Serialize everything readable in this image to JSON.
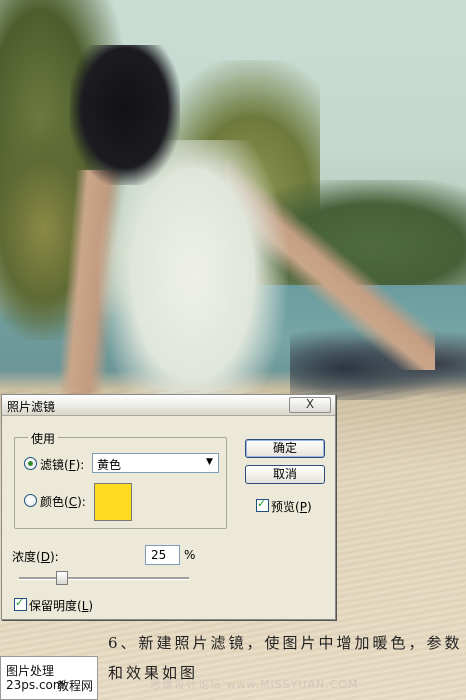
{
  "dialog": {
    "title": "照片滤镜",
    "close_label": "X",
    "use_group_label": "使用",
    "filter_label": "滤镜",
    "filter_hotkey": "F",
    "filter_value": "黄色",
    "color_label": "颜色",
    "color_hotkey": "C",
    "swatch_color": "#ffdb1f",
    "ok_label": "确定",
    "cancel_label": "取消",
    "preview_label": "预览",
    "preview_hotkey": "P",
    "preview_checked": true,
    "density_label": "浓度",
    "density_hotkey": "D",
    "density_value": "25",
    "density_unit": "%",
    "density_slider_fraction": 0.25,
    "preserve_label": "保留明度",
    "preserve_hotkey": "L",
    "preserve_checked": true
  },
  "caption": {
    "line1": "6、新建照片滤镜，使图片中增加暖色，参数",
    "line2": "和效果如图"
  },
  "footer": {
    "logo_line1": "图片处理",
    "logo_site": "23ps.com",
    "logo_tutorial": "教程网",
    "watermark": "思缘设计论坛 www.MISSYUAN.COM"
  }
}
